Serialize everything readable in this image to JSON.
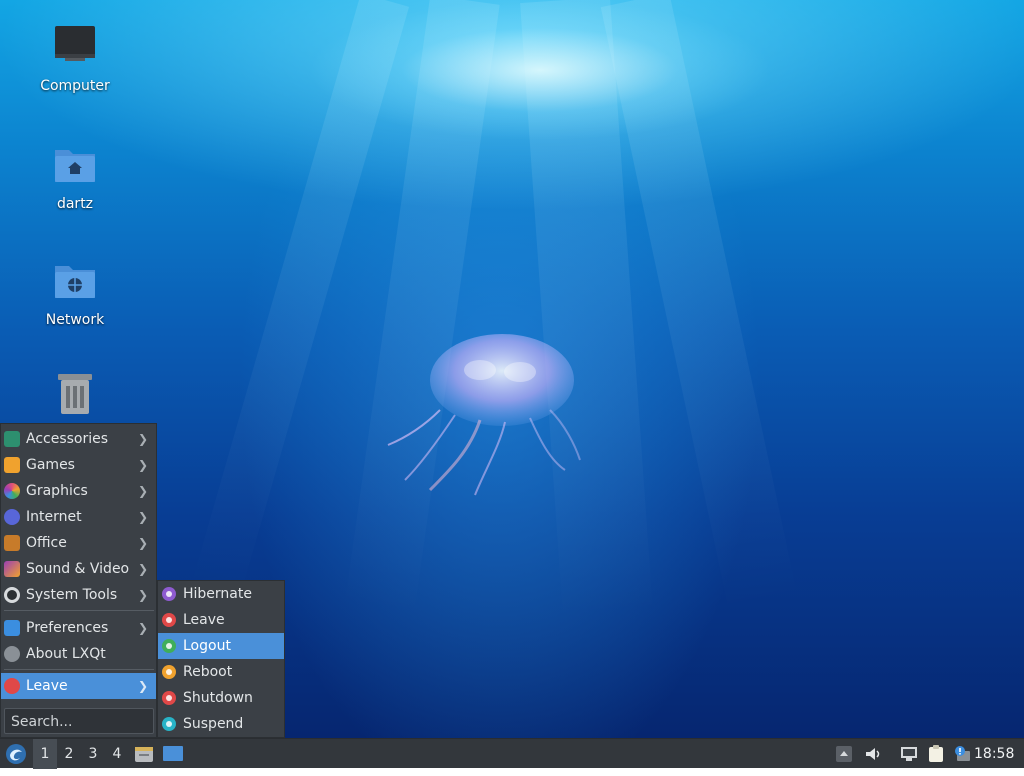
{
  "desktop": {
    "icons": [
      {
        "label": "Computer"
      },
      {
        "label": "dartz"
      },
      {
        "label": "Network"
      },
      {
        "label": ""
      }
    ]
  },
  "menu": {
    "items": [
      {
        "label": "Accessories",
        "icon": "accessories-icon",
        "color": "#2d8f6f",
        "submenu": true
      },
      {
        "label": "Games",
        "icon": "games-icon",
        "color": "#f0a22e",
        "submenu": true
      },
      {
        "label": "Graphics",
        "icon": "graphics-icon",
        "color": "#e0507a",
        "submenu": true
      },
      {
        "label": "Internet",
        "icon": "internet-icon",
        "color": "#5866d8",
        "submenu": true
      },
      {
        "label": "Office",
        "icon": "office-icon",
        "color": "#c77b2a",
        "submenu": true
      },
      {
        "label": "Sound & Video",
        "icon": "sound-video-icon",
        "color": "#9b3fb5",
        "submenu": true
      },
      {
        "label": "System Tools",
        "icon": "system-tools-icon",
        "color": "#d7dadd",
        "submenu": true
      },
      {
        "label": "Preferences",
        "icon": "preferences-icon",
        "color": "#3b8ee0",
        "submenu": true
      },
      {
        "label": "About LXQt",
        "icon": "info-icon",
        "color": "#8a9096",
        "submenu": false
      },
      {
        "label": "Leave",
        "icon": "power-icon",
        "color": "#e04848",
        "submenu": true
      }
    ],
    "search_placeholder": "Search..."
  },
  "leave_menu": {
    "items": [
      {
        "label": "Hibernate",
        "color": "#8e5bd0"
      },
      {
        "label": "Leave",
        "color": "#e04848"
      },
      {
        "label": "Logout",
        "color": "#3fae5a"
      },
      {
        "label": "Reboot",
        "color": "#f0a22e"
      },
      {
        "label": "Shutdown",
        "color": "#e04848"
      },
      {
        "label": "Suspend",
        "color": "#28b3c7"
      }
    ],
    "active": "Logout"
  },
  "taskbar": {
    "desktops": [
      "1",
      "2",
      "3",
      "4"
    ],
    "active_desktop": "1",
    "clock": "18:58"
  },
  "colors": {
    "accent": "#4a90d9",
    "menu_bg": "#3b4046",
    "taskbar_bg": "#33373c"
  }
}
